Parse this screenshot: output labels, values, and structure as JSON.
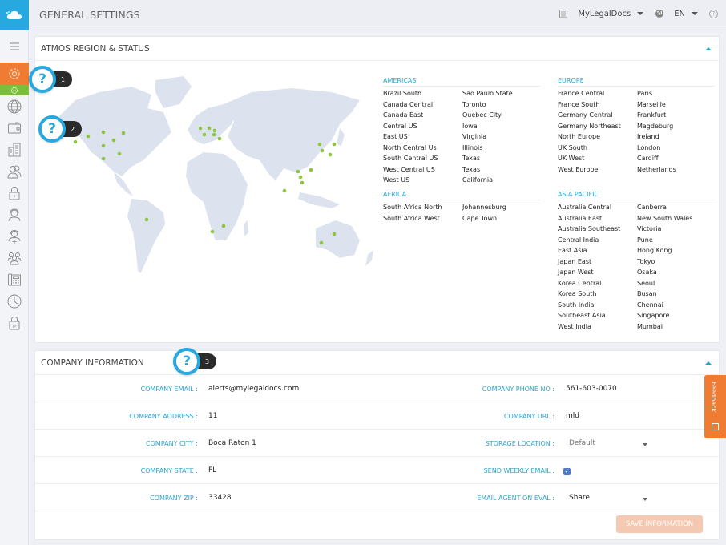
{
  "header": {
    "title": "GENERAL SETTINGS",
    "company_selector": "MyLegalDocs",
    "language_selector": "EN",
    "help_icon": "question-circle-icon",
    "logo_icon": "cloud-icon"
  },
  "colors": {
    "brand_blue": "#27a9df",
    "active_orange": "#f07b32",
    "sub_green": "#7cbd3c",
    "label_blue": "#2aa4cf",
    "map_land": "#dde3ee",
    "map_dot": "#8cc63f"
  },
  "sidebar": {
    "items": [
      {
        "name": "menu",
        "icon": "hamburger-icon"
      },
      {
        "name": "general-settings",
        "icon": "gear-icon",
        "active": true
      },
      {
        "name": "sub-add",
        "icon": "plus-circle-icon"
      },
      {
        "name": "region",
        "icon": "globe-icon"
      },
      {
        "name": "billing",
        "icon": "wallet-icon"
      },
      {
        "name": "company",
        "icon": "buildings-icon"
      },
      {
        "name": "users",
        "icon": "users-icon"
      },
      {
        "name": "security",
        "icon": "lock-icon"
      },
      {
        "name": "agent",
        "icon": "headset-icon"
      },
      {
        "name": "agent-plus",
        "icon": "headset-plus-icon"
      },
      {
        "name": "groups",
        "icon": "group-icon"
      },
      {
        "name": "phone",
        "icon": "desk-phone-icon"
      },
      {
        "name": "hours",
        "icon": "clock-icon"
      },
      {
        "name": "ip-lock",
        "icon": "ip-lock-icon"
      }
    ]
  },
  "help_bubbles": [
    {
      "symbol": "?",
      "number": "1"
    },
    {
      "symbol": "?",
      "number": "2"
    },
    {
      "symbol": "?",
      "number": "3"
    }
  ],
  "region_panel": {
    "title": "ATMOS REGION & STATUS",
    "groups": {
      "americas": {
        "title": "AMERICAS",
        "rows": [
          [
            "Brazil South",
            "Sao Paulo State"
          ],
          [
            "Canada Central",
            "Toronto"
          ],
          [
            "Canada East",
            "Quebec City"
          ],
          [
            "Central US",
            "Iowa"
          ],
          [
            "East US",
            "Virginia"
          ],
          [
            "North Central Us",
            "Illinois"
          ],
          [
            "South Central US",
            "Texas"
          ],
          [
            "West Central US",
            "Texas"
          ],
          [
            "West US",
            "California"
          ]
        ]
      },
      "africa": {
        "title": "AFRICA",
        "rows": [
          [
            "South Africa North",
            "Johannesburg"
          ],
          [
            "South Africa West",
            "Cape Town"
          ]
        ]
      },
      "europe": {
        "title": "EUROPE",
        "rows": [
          [
            "France Central",
            "Paris"
          ],
          [
            "France South",
            "Marseille"
          ],
          [
            "Germany Central",
            "Frankfurt"
          ],
          [
            "Germany Northeast",
            "Magdeburg"
          ],
          [
            "North Europe",
            "Ireland"
          ],
          [
            "UK South",
            "London"
          ],
          [
            "UK West",
            "Cardiff"
          ],
          [
            "West Europe",
            "Netherlands"
          ]
        ]
      },
      "asia_pacific": {
        "title": "ASIA PACIFIC",
        "rows": [
          [
            "Australia Central",
            "Canberra"
          ],
          [
            "Australia East",
            "New South Wales"
          ],
          [
            "Australia Southeast",
            "Victoria"
          ],
          [
            "Central India",
            "Pune"
          ],
          [
            "East Asia",
            "Hong Kong"
          ],
          [
            "Japan East",
            "Tokyo"
          ],
          [
            "Japan West",
            "Osaka"
          ],
          [
            "Korea Central",
            "Seoul"
          ],
          [
            "Korea South",
            "Busan"
          ],
          [
            "South India",
            "Chennai"
          ],
          [
            "Southeast Asia",
            "Singapore"
          ],
          [
            "West India",
            "Mumbai"
          ]
        ]
      }
    }
  },
  "company_panel": {
    "title": "COMPANY INFORMATION",
    "left_fields": [
      {
        "label": "COMPANY EMAIL :",
        "value": "alerts@mylegaldocs.com"
      },
      {
        "label": "COMPANY ADDRESS :",
        "value": "11"
      },
      {
        "label": "COMPANY CITY :",
        "value": "Boca Raton 1"
      },
      {
        "label": "COMPANY STATE :",
        "value": "FL"
      },
      {
        "label": "COMPANY ZIP :",
        "value": "33428"
      }
    ],
    "right_fields": [
      {
        "label": "COMPANY PHONE NO :",
        "value": "561-603-0070",
        "type": "text"
      },
      {
        "label": "COMPANY URL :",
        "value": "mld",
        "type": "text"
      },
      {
        "label": "STORAGE LOCATION :",
        "value": "Default",
        "type": "select"
      },
      {
        "label": "SEND WEEKLY EMAIL :",
        "checked": true,
        "type": "checkbox"
      },
      {
        "label": "EMAIL AGENT ON EVAL :",
        "value": "Share",
        "type": "select"
      }
    ],
    "save_label": "SAVE INFORMATION"
  },
  "feedback": {
    "label": "Feedback"
  }
}
